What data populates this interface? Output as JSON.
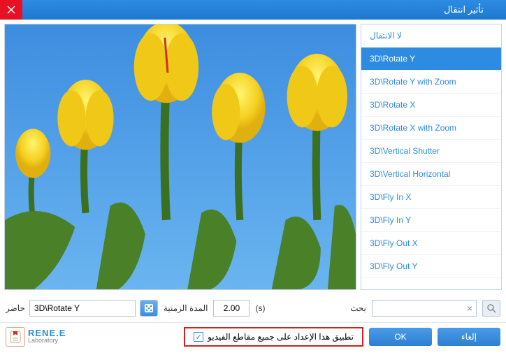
{
  "window": {
    "title": "تأثير انتقال"
  },
  "effects": {
    "items": [
      {
        "label": "لا الانتقال",
        "selected": false
      },
      {
        "label": "3D\\Rotate Y",
        "selected": true
      },
      {
        "label": "3D\\Rotate Y with Zoom",
        "selected": false
      },
      {
        "label": "3D\\Rotate X",
        "selected": false
      },
      {
        "label": "3D\\Rotate X with Zoom",
        "selected": false
      },
      {
        "label": "3D\\Vertical Shutter",
        "selected": false
      },
      {
        "label": "3D\\Vertical Horizontal",
        "selected": false
      },
      {
        "label": "3D\\Fly In X",
        "selected": false
      },
      {
        "label": "3D\\Fly In Y",
        "selected": false
      },
      {
        "label": "3D\\Fly Out X",
        "selected": false
      },
      {
        "label": "3D\\Fly Out Y",
        "selected": false
      }
    ]
  },
  "controls": {
    "current_label": "حاضر",
    "current_value": "3D\\Rotate Y",
    "duration_label": "المدة الزمنية",
    "duration_value": "2.00",
    "duration_unit": "(s)",
    "search_label": "بحث",
    "search_value": ""
  },
  "footer": {
    "logo_line1": "RENE.E",
    "logo_line2": "Laboratory",
    "apply_all_label": "تطبيق هذا الإعداد على جميع مقاطع الفيديو",
    "apply_all_checked": true,
    "ok_label": "OK",
    "cancel_label": "إلغاء"
  }
}
